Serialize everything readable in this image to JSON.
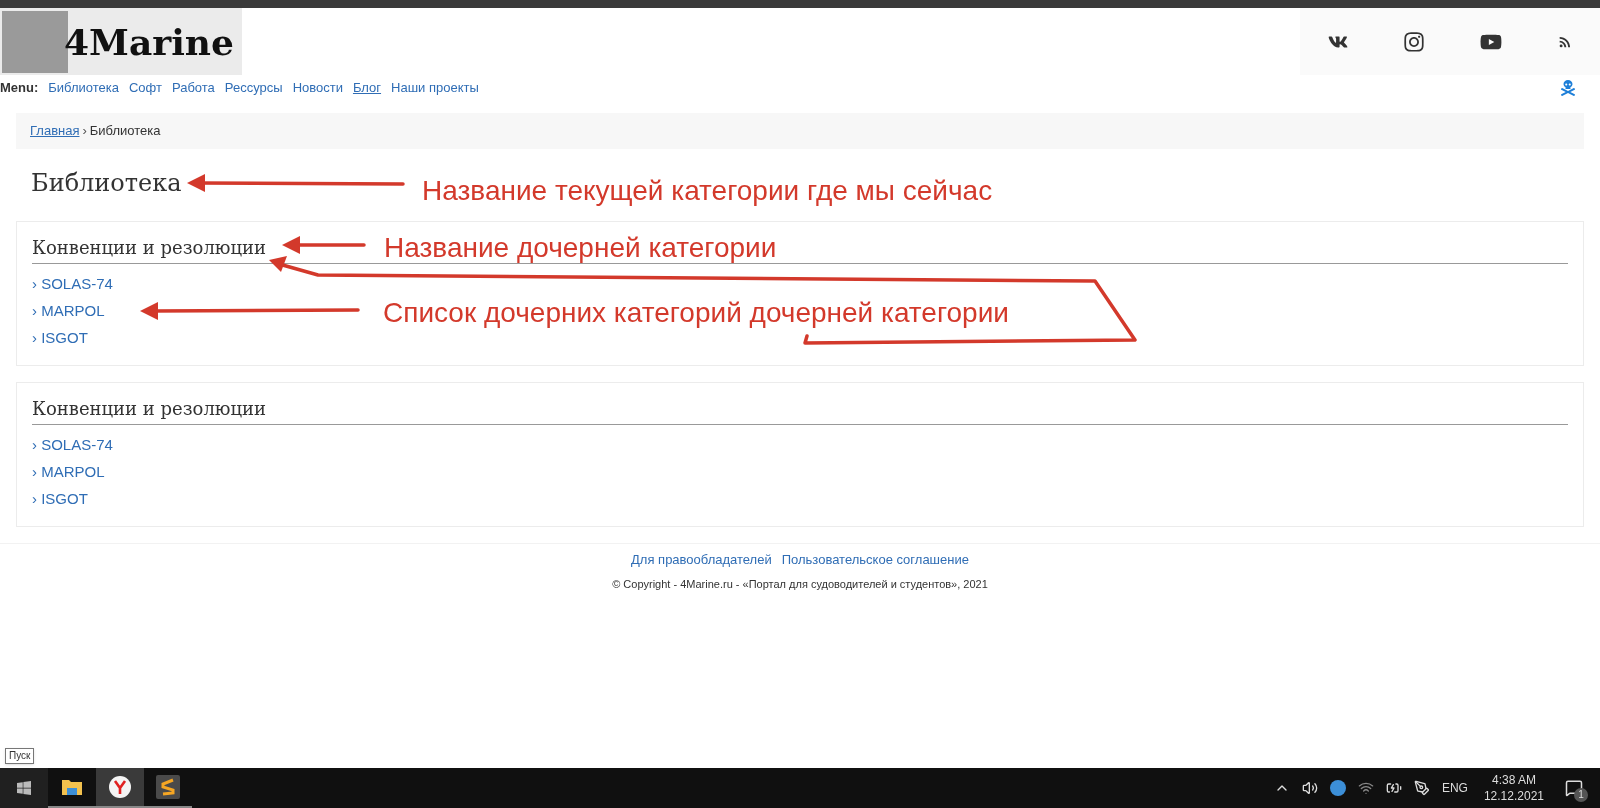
{
  "header": {
    "logo_text": "4Marine"
  },
  "menu": {
    "label": "Menu:",
    "items": [
      {
        "label": "Библиотека",
        "selected": false
      },
      {
        "label": "Софт",
        "selected": false
      },
      {
        "label": "Работа",
        "selected": false
      },
      {
        "label": "Рессурсы",
        "selected": false
      },
      {
        "label": "Новости",
        "selected": false
      },
      {
        "label": "Блог",
        "selected": true
      },
      {
        "label": "Наши проекты",
        "selected": false
      }
    ]
  },
  "breadcrumb": {
    "items": [
      "Главная",
      "Библиотека"
    ],
    "separator": "›"
  },
  "page_title": "Библиотека",
  "sections": [
    {
      "title": "Конвенции и резолюции",
      "items": [
        "› SOLAS-74",
        "› MARPOL",
        "› ISGOT"
      ]
    },
    {
      "title": "Конвенции и резолюции",
      "items": [
        "› SOLAS-74",
        "› MARPOL",
        "› ISGOT"
      ]
    }
  ],
  "footer": {
    "links": [
      "Для правообладателей",
      "Пользовательское соглашение"
    ],
    "copyright": "© Copyright - 4Marine.ru - «Портал для судоводителей и студентов», 2021"
  },
  "annotations": [
    {
      "text": "Название текущей категории где мы сейчас"
    },
    {
      "text": "Название дочерней категории"
    },
    {
      "text": "Список дочерних категорий дочерней категории"
    }
  ],
  "tooltip": "Пуск",
  "taskbar": {
    "apps": [
      {
        "kind": "explorer",
        "selected": false
      },
      {
        "kind": "browser",
        "selected": true
      },
      {
        "kind": "editor",
        "selected": false
      }
    ],
    "language": "ENG",
    "time": "4:38 AM",
    "date": "12.12.2021",
    "notifications": "1"
  }
}
